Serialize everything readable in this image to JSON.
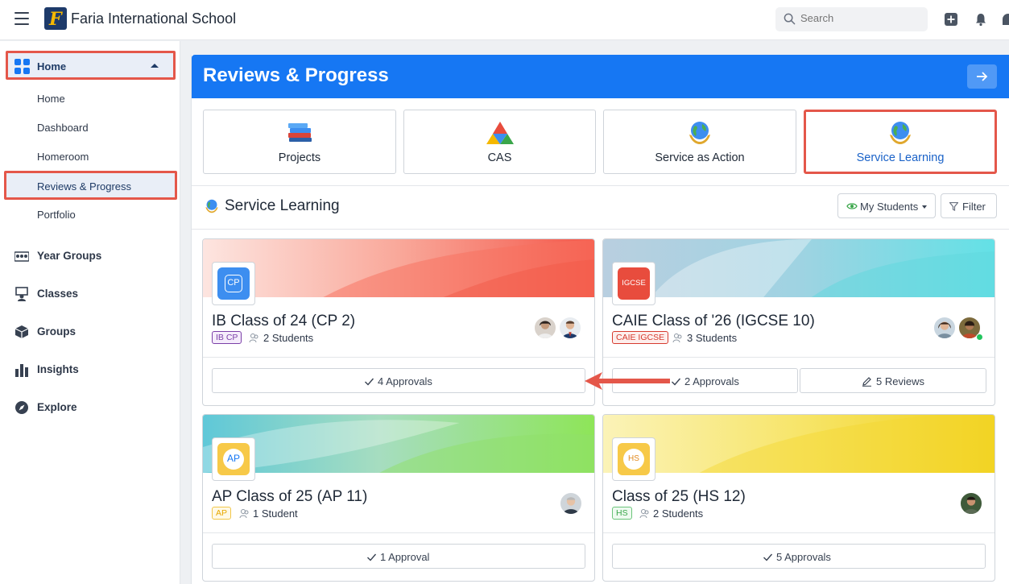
{
  "topbar": {
    "school_name": "Faria International School",
    "logo_letter": "F",
    "search_placeholder": "Search"
  },
  "sidebar": {
    "home_label": "Home",
    "sub_items": [
      {
        "label": "Home"
      },
      {
        "label": "Dashboard"
      },
      {
        "label": "Homeroom"
      },
      {
        "label": "Reviews & Progress"
      },
      {
        "label": "Portfolio"
      }
    ],
    "main_items": [
      {
        "label": "Year Groups",
        "icon": "year-groups-icon"
      },
      {
        "label": "Classes",
        "icon": "classes-icon"
      },
      {
        "label": "Groups",
        "icon": "groups-icon"
      },
      {
        "label": "Insights",
        "icon": "insights-icon"
      },
      {
        "label": "Explore",
        "icon": "explore-icon"
      }
    ]
  },
  "panel": {
    "title": "Reviews & Progress",
    "types": [
      {
        "label": "Projects"
      },
      {
        "label": "CAS"
      },
      {
        "label": "Service as Action"
      },
      {
        "label": "Service Learning"
      }
    ],
    "section_title": "Service Learning",
    "my_students_label": "My Students",
    "filter_label": "Filter"
  },
  "cards": [
    {
      "name": "IB Class of 24 (CP 2)",
      "badge": "CP",
      "tag": "IB CP",
      "students": "2 Students",
      "actions": [
        "4 Approvals"
      ]
    },
    {
      "name": "CAIE Class of '26 (IGCSE 10)",
      "badge": "IGCSE",
      "tag": "CAIE IGCSE",
      "students": "3 Students",
      "actions": [
        "2 Approvals",
        "5 Reviews"
      ]
    },
    {
      "name": "AP Class of 25 (AP 11)",
      "badge": "AP",
      "tag": "AP",
      "students": "1 Student",
      "actions": [
        "1 Approval"
      ]
    },
    {
      "name": "Class of 25 (HS 12)",
      "badge": "HS",
      "tag": "HS",
      "students": "2 Students",
      "actions": [
        "5 Approvals"
      ]
    }
  ],
  "colors": {
    "accent_blue": "#1677f3",
    "highlight_red": "#e4574a",
    "cp_badge": "#3d8ef0",
    "igcse_badge": "#e84c3d",
    "ap_badge": "#f7c948",
    "hs_badge": "#f7c948"
  }
}
